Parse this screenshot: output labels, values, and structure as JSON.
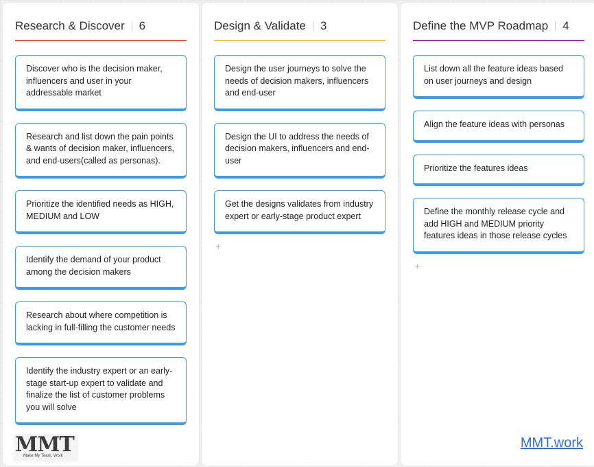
{
  "columns": [
    {
      "title": "Research & Discover",
      "count": "6",
      "accent": "#e8553f",
      "cards": [
        "Discover who is the decision maker, influencers and user in your addressable market",
        "Research and list down the pain points & wants of decision maker, influencers, and end-users(called as personas).",
        "Prioritize the identified needs as HIGH, MEDIUM and LOW",
        "Identify the demand of your product among the decision makers",
        "Research about where competition is lacking in full-filling the customer needs",
        "Identify the industry expert or an early-stage start-up expert to validate and finalize the list of customer problems you will solve"
      ]
    },
    {
      "title": "Design & Validate",
      "count": "3",
      "accent": "#f3c63c",
      "cards": [
        "Design the user journeys to solve the needs of decision makers, influencers and end-user",
        "Design the UI to address the needs of decision makers, influencers and end-user",
        "Get the designs validates from industry expert or early-stage product expert"
      ]
    },
    {
      "title": "Define the MVP Roadmap",
      "count": "4",
      "accent": "#9b2fb6",
      "cards": [
        "List down all the feature ideas based on user journeys and design",
        "Align the feature ideas with personas",
        "Prioritize the features ideas",
        "Define the monthly release cycle and add HIGH and MEDIUM priority features ideas in those release cycles"
      ]
    }
  ],
  "add_icon": "plus-icon",
  "add_glyph": "+",
  "card_border_color": "#3b9be6",
  "logo": {
    "mark": "MMT",
    "tagline": "Make My Team, Work"
  },
  "footer_link": "MMT.work"
}
